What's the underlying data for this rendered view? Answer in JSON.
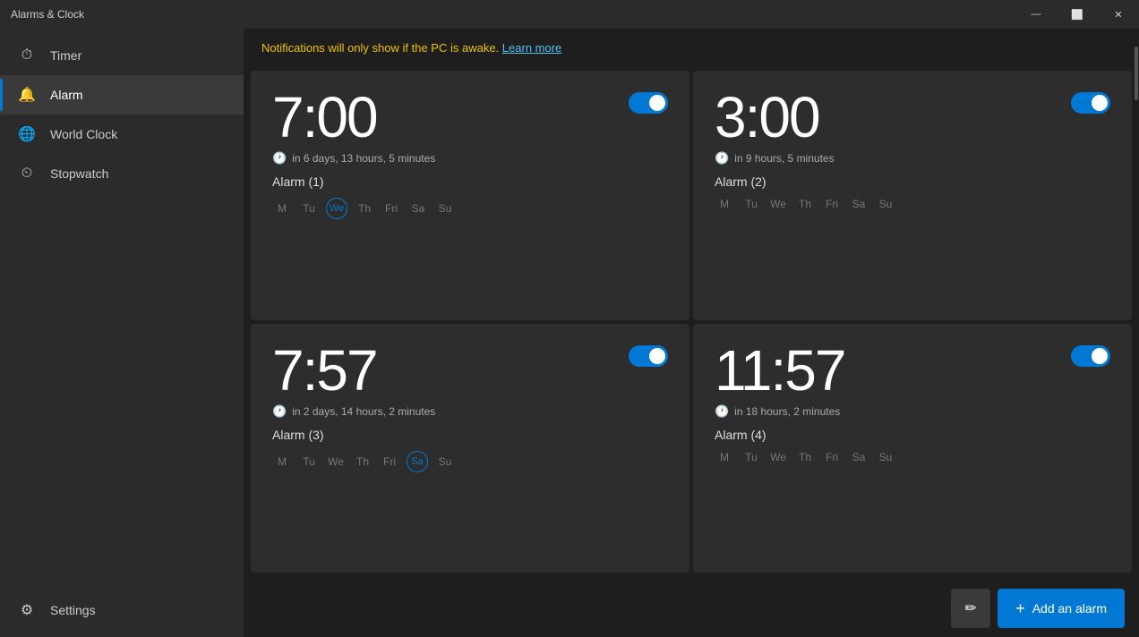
{
  "titleBar": {
    "title": "Alarms & Clock",
    "minimizeLabel": "—",
    "maximizeLabel": "⬜",
    "closeLabel": "✕"
  },
  "notification": {
    "text": "Notifications will only show if the PC is awake.",
    "linkText": "Learn more"
  },
  "sidebar": {
    "items": [
      {
        "id": "timer",
        "label": "Timer",
        "icon": "⏱"
      },
      {
        "id": "alarm",
        "label": "Alarm",
        "icon": "🔔"
      },
      {
        "id": "world-clock",
        "label": "World Clock",
        "icon": "🌐"
      },
      {
        "id": "stopwatch",
        "label": "Stopwatch",
        "icon": "⏲"
      }
    ],
    "activeItem": "alarm",
    "settings": {
      "label": "Settings",
      "icon": "⚙"
    }
  },
  "alarms": [
    {
      "id": 1,
      "time": "7:00",
      "enabled": true,
      "subtitle": "in 6 days, 13 hours, 5 minutes",
      "name": "Alarm (1)",
      "days": [
        "M",
        "Tu",
        "We",
        "Th",
        "Fri",
        "Sa",
        "Su"
      ],
      "activeDays": [
        "We"
      ]
    },
    {
      "id": 2,
      "time": "3:00",
      "enabled": true,
      "subtitle": "in 9 hours, 5 minutes",
      "name": "Alarm (2)",
      "days": [
        "M",
        "Tu",
        "We",
        "Th",
        "Fri",
        "Sa",
        "Su"
      ],
      "activeDays": []
    },
    {
      "id": 3,
      "time": "7:57",
      "enabled": true,
      "subtitle": "in 2 days, 14 hours, 2 minutes",
      "name": "Alarm (3)",
      "days": [
        "M",
        "Tu",
        "We",
        "Th",
        "Fri",
        "Sa",
        "Su"
      ],
      "activeDays": [
        "Sa"
      ]
    },
    {
      "id": 4,
      "time": "11:57",
      "enabled": true,
      "subtitle": "in 18 hours, 2 minutes",
      "name": "Alarm (4)",
      "days": [
        "M",
        "Tu",
        "We",
        "Th",
        "Fri",
        "Sa",
        "Su"
      ],
      "activeDays": []
    }
  ],
  "bottomBar": {
    "editIcon": "✏",
    "addLabel": "Add an alarm",
    "addIcon": "+"
  }
}
